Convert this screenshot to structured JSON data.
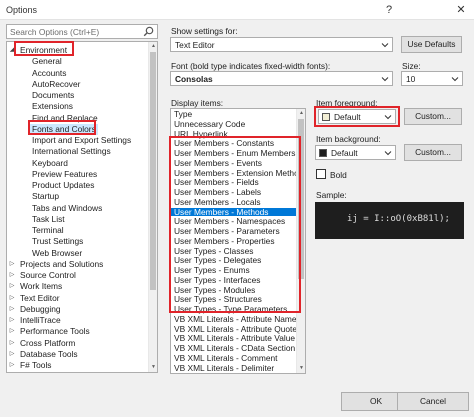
{
  "window": {
    "title": "Options",
    "help": "?",
    "close": "✕"
  },
  "search": {
    "placeholder": "Search Options (Ctrl+E)"
  },
  "tree": {
    "items": [
      {
        "label": "Environment",
        "level": 0,
        "expanded": true
      },
      {
        "label": "General",
        "level": 1
      },
      {
        "label": "Accounts",
        "level": 1
      },
      {
        "label": "AutoRecover",
        "level": 1
      },
      {
        "label": "Documents",
        "level": 1
      },
      {
        "label": "Extensions",
        "level": 1
      },
      {
        "label": "Find and Replace",
        "level": 1
      },
      {
        "label": "Fonts and Colors",
        "level": 1,
        "selected": true
      },
      {
        "label": "Import and Export Settings",
        "level": 1
      },
      {
        "label": "International Settings",
        "level": 1
      },
      {
        "label": "Keyboard",
        "level": 1
      },
      {
        "label": "Preview Features",
        "level": 1
      },
      {
        "label": "Product Updates",
        "level": 1
      },
      {
        "label": "Startup",
        "level": 1
      },
      {
        "label": "Tabs and Windows",
        "level": 1
      },
      {
        "label": "Task List",
        "level": 1
      },
      {
        "label": "Terminal",
        "level": 1
      },
      {
        "label": "Trust Settings",
        "level": 1
      },
      {
        "label": "Web Browser",
        "level": 1
      },
      {
        "label": "Projects and Solutions",
        "level": 0
      },
      {
        "label": "Source Control",
        "level": 0
      },
      {
        "label": "Work Items",
        "level": 0
      },
      {
        "label": "Text Editor",
        "level": 0
      },
      {
        "label": "Debugging",
        "level": 0
      },
      {
        "label": "IntelliTrace",
        "level": 0
      },
      {
        "label": "Performance Tools",
        "level": 0
      },
      {
        "label": "Cross Platform",
        "level": 0
      },
      {
        "label": "Database Tools",
        "level": 0
      },
      {
        "label": "F# Tools",
        "level": 0
      }
    ]
  },
  "settings": {
    "show_for_label": "Show settings for:",
    "show_for_value": "Text Editor",
    "use_defaults": "Use Defaults",
    "font_label": "Font (bold type indicates fixed-width fonts):",
    "font_value": "Consolas",
    "size_label": "Size:",
    "size_value": "10",
    "display_items_label": "Display items:",
    "display_items": [
      "Type",
      "Unnecessary Code",
      "URL Hyperlink",
      "User Members - Constants",
      "User Members - Enum Members",
      "User Members - Events",
      "User Members - Extension Methods",
      "User Members - Fields",
      "User Members - Labels",
      "User Members - Locals",
      "User Members - Methods",
      "User Members - Namespaces",
      "User Members - Parameters",
      "User Members - Properties",
      "User Types - Classes",
      "User Types - Delegates",
      "User Types - Enums",
      "User Types - Interfaces",
      "User Types - Modules",
      "User Types - Structures",
      "User Types - Type Parameters",
      "VB XML Literals - Attribute Name",
      "VB XML Literals - Attribute Quotes",
      "VB XML Literals - Attribute Value",
      "VB XML Literals - CData Section",
      "VB XML Literals - Comment",
      "VB XML Literals - Delimiter"
    ],
    "selected_item": "User Members - Methods",
    "foreground_label": "Item foreground:",
    "foreground_value": "Default",
    "foreground_color": "#f3efd5",
    "custom_fg": "Custom...",
    "background_label": "Item background:",
    "background_value": "Default",
    "background_color": "#1e1e1e",
    "custom_bg": "Custom...",
    "bold_label": "Bold",
    "sample_label": "Sample:",
    "sample_text": "ij = I::oO(0xB81l);"
  },
  "footer": {
    "ok": "OK",
    "cancel": "Cancel"
  },
  "colors": {
    "highlight": "#e0242a",
    "selection": "#0078d7",
    "tree_selection": "#cce8ff"
  }
}
